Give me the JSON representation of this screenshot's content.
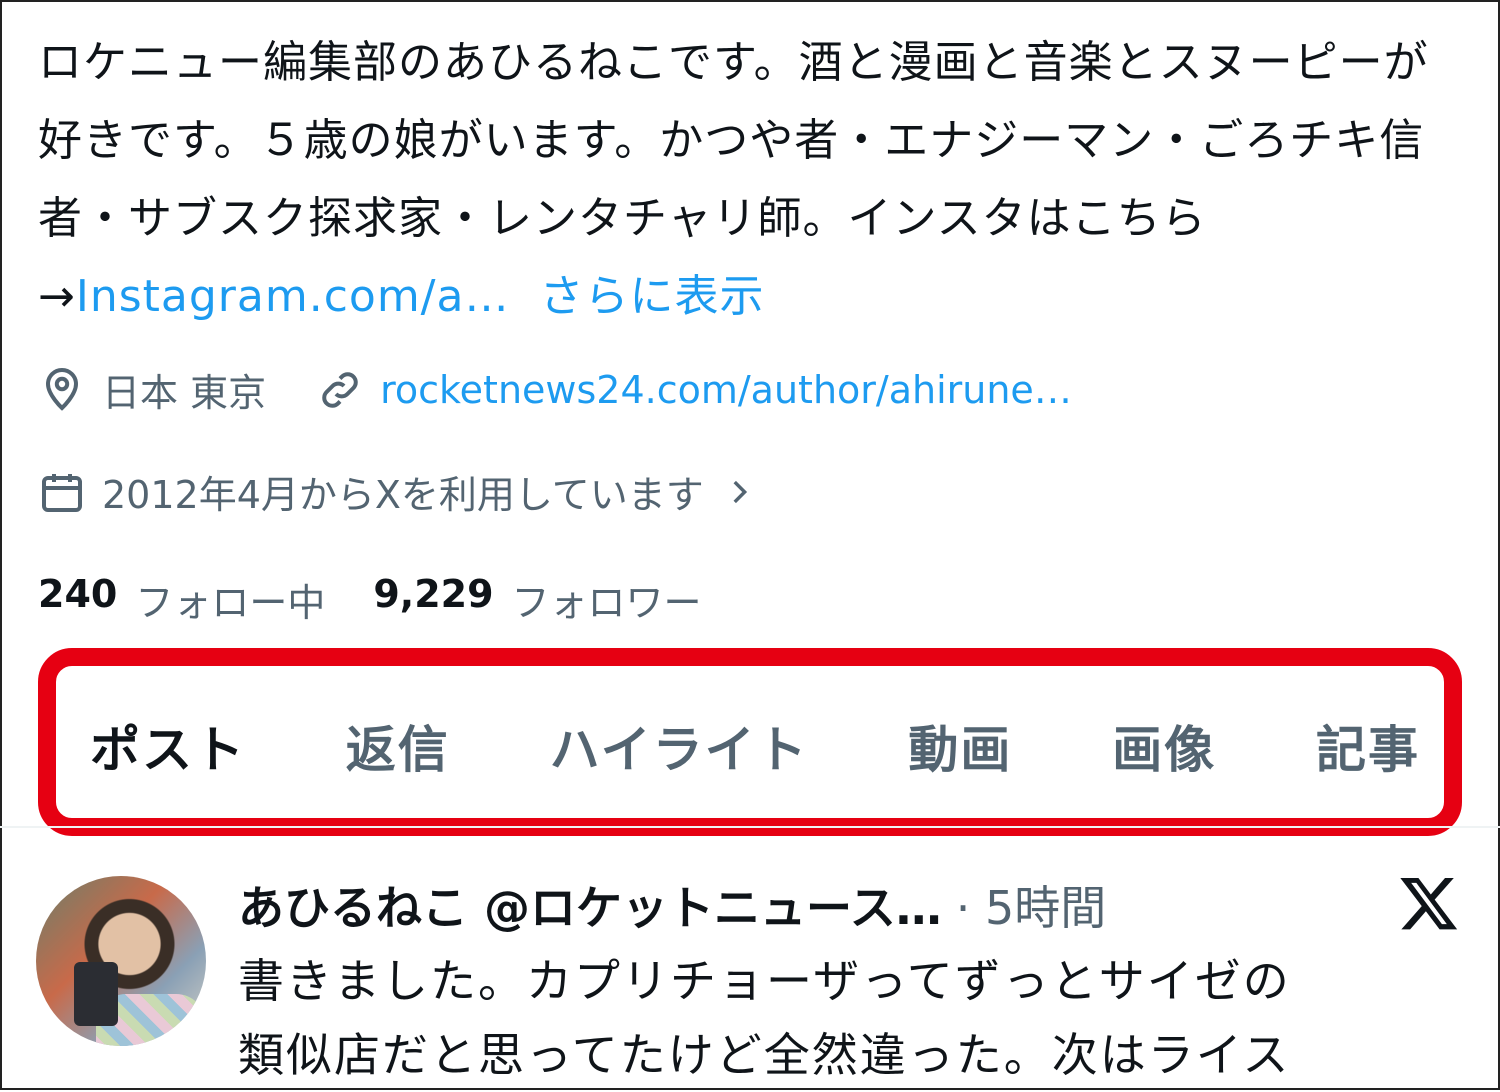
{
  "profile": {
    "bio_text": "ロケニュー編集部のあひるねこです。酒と漫画と音楽とスヌーピーが好きです。５歳の娘がいます。かつや者・エナジーマン・ごろチキ信者・サブスク探求家・レンタチャリ師。インスタはこちら →",
    "bio_link": "Instagram.com/a…",
    "show_more": "さらに表示",
    "location": "日本 東京",
    "website": "rocketnews24.com/author/ahirune…",
    "joined": "2012年4月からXを利用しています",
    "following_count": "240",
    "following_label": "フォロー中",
    "followers_count": "9,229",
    "followers_label": "フォロワー"
  },
  "tabs": [
    {
      "label": "ポスト",
      "active": true
    },
    {
      "label": "返信",
      "active": false
    },
    {
      "label": "ハイライト",
      "active": false
    },
    {
      "label": "動画",
      "active": false
    },
    {
      "label": "画像",
      "active": false
    },
    {
      "label": "記事",
      "active": false
    }
  ],
  "post": {
    "author": "あひるねこ @ロケットニュース…",
    "time": "· 5時間",
    "body_line1": "書きました。カプリチョーザってずっとサイゼの",
    "body_line2": "類似店だと思ってたけど全然違った。次はライス"
  },
  "colors": {
    "accent": "#1d9bf0",
    "highlight_border": "#e60012",
    "muted": "#536471",
    "text": "#0f1419"
  },
  "icons": [
    "location-icon",
    "link-icon",
    "calendar-icon",
    "chevron-right-icon",
    "x-logo-icon"
  ]
}
